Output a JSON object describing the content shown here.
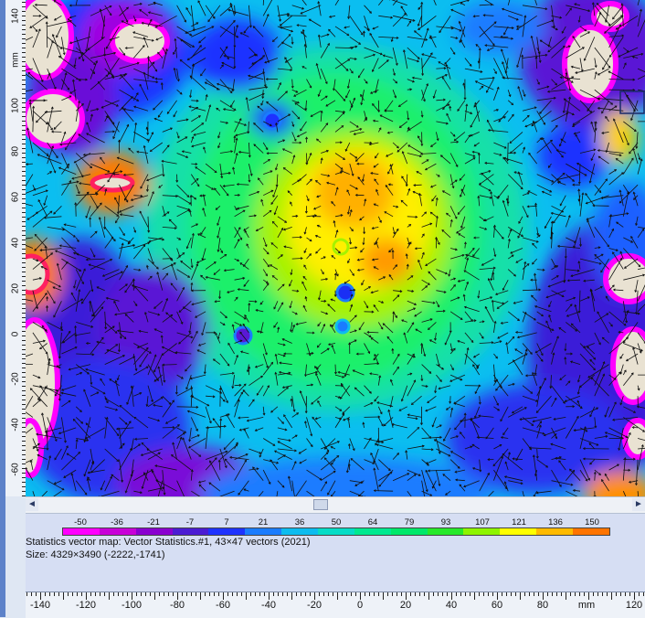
{
  "window": {
    "bg": "#dfe7f3"
  },
  "colormap": {
    "labels": [
      "-50",
      "-36",
      "-21",
      "-7",
      "7",
      "21",
      "36",
      "50",
      "64",
      "79",
      "93",
      "107",
      "121",
      "136",
      "150"
    ],
    "colors": [
      "#ff00ff",
      "#c800d8",
      "#8a00d0",
      "#4b1cd3",
      "#1e32ff",
      "#1a7cff",
      "#0cbcef",
      "#06dcc6",
      "#00e990",
      "#00e86a",
      "#27e92a",
      "#8ef400",
      "#ffff00",
      "#ffba00",
      "#ff7400"
    ]
  },
  "info": {
    "line1": "Statistics vector map: Vector Statistics.#1, 43×47 vectors (2021)",
    "line2": "Size: 4329×3490 (-2222,-1741)"
  },
  "vruler": {
    "labels": [
      "140",
      "mm",
      "100",
      "80",
      "60",
      "40",
      "20",
      "0",
      "-20",
      "-40",
      "-60"
    ]
  },
  "hruler": {
    "labels": [
      "-140",
      "-120",
      "-100",
      "-80",
      "-60",
      "-40",
      "-20",
      "0",
      "20",
      "40",
      "60",
      "80",
      "mm",
      "120"
    ]
  },
  "scroll": {
    "left_arrow": "◄",
    "right_arrow": "►"
  },
  "map_title": "Statistics vector map"
}
